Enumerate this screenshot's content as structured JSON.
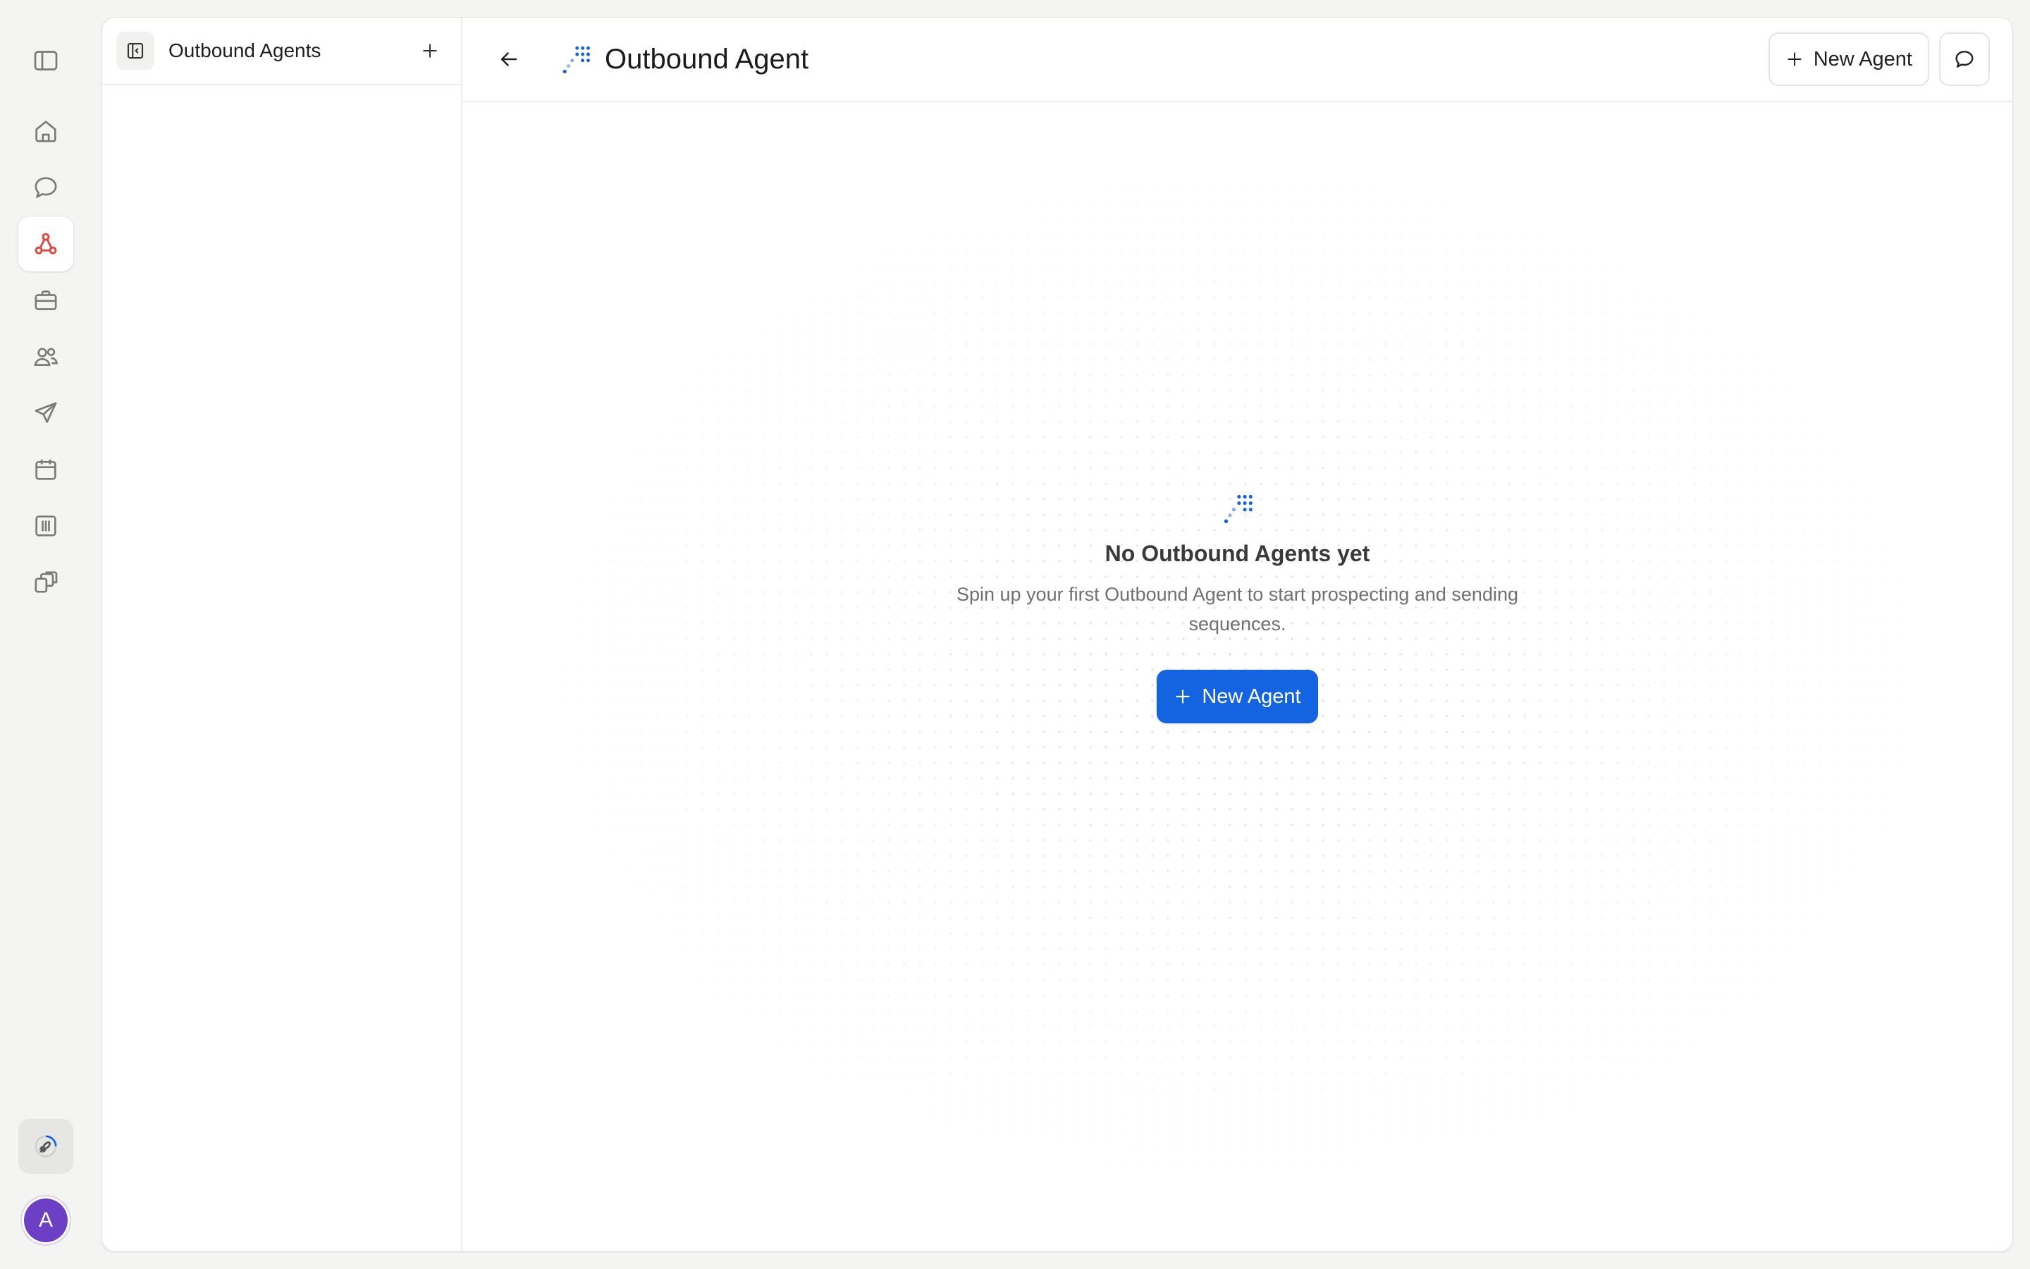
{
  "nav": {
    "items": [
      {
        "icon": "sidebar-toggle-icon"
      },
      {
        "icon": "home-icon"
      },
      {
        "icon": "chat-bubble-icon"
      },
      {
        "icon": "agents-network-icon",
        "active": true
      },
      {
        "icon": "briefcase-icon"
      },
      {
        "icon": "contacts-icon"
      },
      {
        "icon": "send-icon"
      },
      {
        "icon": "calendar-icon"
      },
      {
        "icon": "table-columns-icon"
      },
      {
        "icon": "integrations-icon"
      },
      {
        "icon": "rocket-launch-icon"
      }
    ],
    "avatar_initial": "A",
    "avatar_color": "#6c3fc4",
    "active_color": "#e0443e"
  },
  "list_pane": {
    "title": "Outbound Agents"
  },
  "header": {
    "title": "Outbound Agent",
    "new_button_label": "New Agent"
  },
  "empty_state": {
    "title": "No Outbound Agents yet",
    "description": "Spin up your first Outbound Agent to start prospecting and sending sequences.",
    "button_label": "New Agent"
  },
  "colors": {
    "accent": "#1463e0",
    "background": "#f4f4f3"
  }
}
